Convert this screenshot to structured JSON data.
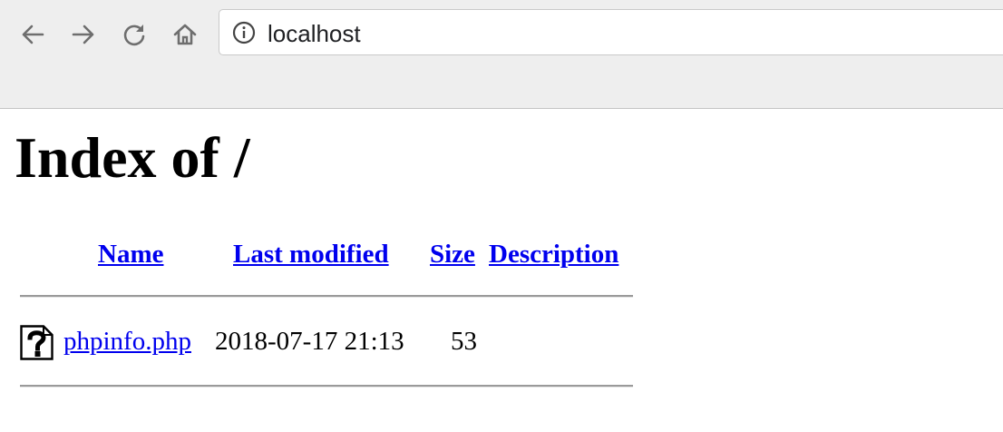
{
  "browser": {
    "url": "localhost",
    "icons": {
      "back": "arrow-left-icon",
      "forward": "arrow-right-icon",
      "reload": "reload-icon",
      "home": "home-icon",
      "site_info": "info-icon"
    }
  },
  "page": {
    "title": "Index of /",
    "columns": {
      "name": "Name",
      "last_modified": "Last modified",
      "size": "Size",
      "description": "Description"
    },
    "files": [
      {
        "icon": "unknown-file-icon",
        "name": "phpinfo.php",
        "last_modified": "2018-07-17 21:13",
        "size": "53",
        "description": ""
      }
    ]
  },
  "colors": {
    "link": "#0000ee",
    "toolbar_bg": "#eeeeee",
    "rule": "#9a9a9a"
  }
}
